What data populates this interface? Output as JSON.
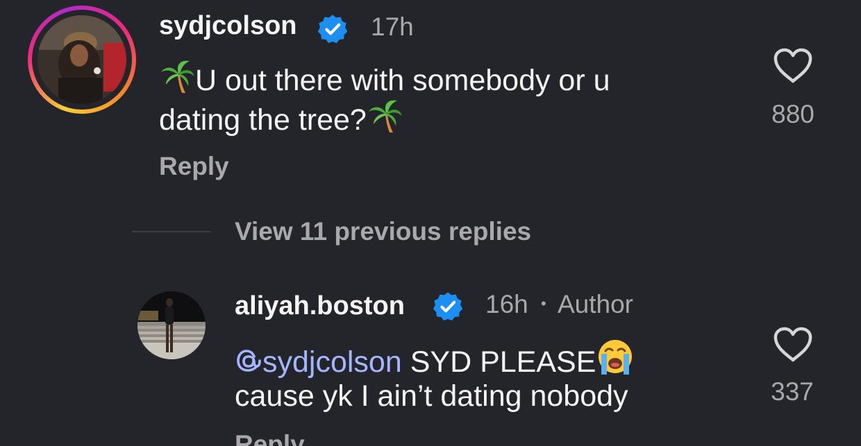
{
  "comments": [
    {
      "username": "sydjcolson",
      "time": "17h",
      "line1": "U out there with somebody or u",
      "line2": "dating the tree?",
      "reply_label": "Reply",
      "likes": "880"
    },
    {
      "username": "aliyah.boston",
      "time": "16h",
      "separator": "•",
      "author_label": "Author",
      "mention": "sydjcolson",
      "line1": "SYD PLEASE",
      "line2": "cause yk I ain’t dating nobody",
      "reply_label": "Reply",
      "likes": "337"
    }
  ],
  "view_replies_label": "View 11 previous replies",
  "colors": {
    "background": "#24252b",
    "verified": "#1d8ff2",
    "mention": "#a4b6ff",
    "muted": "#a8a8ad"
  },
  "icons": {
    "verified": "verified-badge-icon",
    "like": "heart-icon",
    "emoji_palm": "palm-tree-emoji",
    "emoji_cry": "loudly-crying-face-emoji",
    "mention": "threads-at-icon"
  }
}
